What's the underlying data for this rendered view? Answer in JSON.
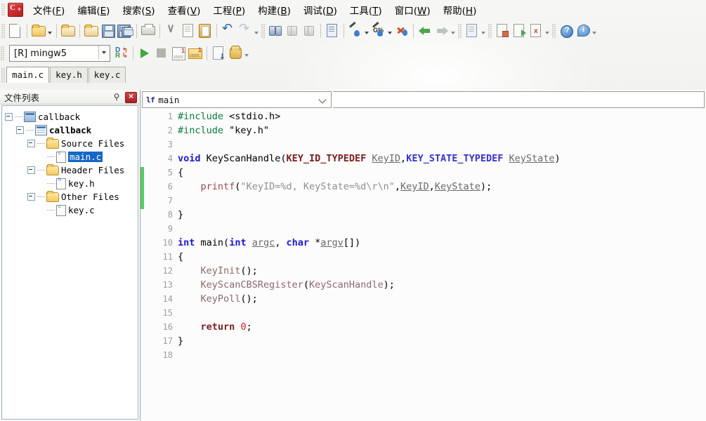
{
  "app": {
    "logo": "devcpp-logo",
    "menu": [
      {
        "label": "文件",
        "accel": "F"
      },
      {
        "label": "编辑",
        "accel": "E"
      },
      {
        "label": "搜索",
        "accel": "S"
      },
      {
        "label": "查看",
        "accel": "V"
      },
      {
        "label": "工程",
        "accel": "P"
      },
      {
        "label": "构建",
        "accel": "B"
      },
      {
        "label": "调试",
        "accel": "D"
      },
      {
        "label": "工具",
        "accel": "T"
      },
      {
        "label": "窗口",
        "accel": "W"
      },
      {
        "label": "帮助",
        "accel": "H"
      }
    ]
  },
  "toolbar": {
    "items": [
      {
        "icon": "new-file-icon"
      },
      {
        "icon": "open-folder-icon"
      },
      {
        "icon": "open-dropdown-caret"
      },
      {
        "icon": "save-project-icon"
      },
      {
        "icon": "save-as-icon"
      },
      {
        "icon": "save-icon"
      },
      {
        "icon": "save-all-icon"
      },
      {
        "icon": "print-icon"
      },
      {
        "icon": "cut-icon"
      },
      {
        "icon": "copy-icon"
      },
      {
        "icon": "paste-icon"
      },
      {
        "icon": "undo-icon"
      },
      {
        "icon": "redo-icon"
      },
      {
        "icon": "redo-dropdown-caret"
      },
      {
        "icon": "find-icon"
      },
      {
        "icon": "find-next-icon"
      },
      {
        "icon": "find-prev-icon"
      },
      {
        "icon": "goto-line-icon"
      },
      {
        "icon": "compile-icon"
      },
      {
        "icon": "compile-dropdown-caret"
      },
      {
        "icon": "compile-run-icon"
      },
      {
        "icon": "compile-run-dropdown-caret"
      },
      {
        "icon": "rebuild-icon"
      },
      {
        "icon": "back-icon"
      },
      {
        "icon": "forward-icon"
      },
      {
        "icon": "nav-dropdown-caret"
      },
      {
        "icon": "insert-snippet-icon"
      },
      {
        "icon": "toggle-bookmark-icon"
      },
      {
        "icon": "goto-bookmark-icon"
      },
      {
        "icon": "remove-bookmark-icon"
      },
      {
        "icon": "bookmark-dropdown-caret"
      },
      {
        "icon": "help-icon"
      },
      {
        "icon": "about-icon"
      },
      {
        "icon": "help-dropdown-caret"
      }
    ]
  },
  "compiler_bar": {
    "compiler_value": "[R] mingw5",
    "compiler_dropdown_icon": "chevron-down-icon",
    "items": [
      {
        "icon": "debug-run-icon"
      },
      {
        "icon": "run-icon"
      },
      {
        "icon": "stop-icon"
      },
      {
        "icon": "step-into-icon"
      },
      {
        "icon": "step-over-icon"
      },
      {
        "icon": "goto-definition-icon"
      },
      {
        "icon": "pause-icon"
      },
      {
        "icon": "debug-dropdown-caret"
      }
    ]
  },
  "file_tabs": {
    "tabs": [
      {
        "label": "main.c",
        "active": true
      },
      {
        "label": "key.h",
        "active": false
      },
      {
        "label": "key.c",
        "active": false
      }
    ]
  },
  "left_panel": {
    "title": "文件列表",
    "pin_icon": "pin-icon",
    "close_icon": "close-icon",
    "tree": [
      {
        "label": "callback",
        "indent": 0,
        "icon": "project-icon",
        "expander": true,
        "bold": false,
        "selected": false
      },
      {
        "label": "callback",
        "indent": 1,
        "icon": "subproject-icon",
        "expander": true,
        "bold": true,
        "selected": false
      },
      {
        "label": "Source Files",
        "indent": 2,
        "icon": "folder-icon",
        "expander": true,
        "bold": false,
        "selected": false
      },
      {
        "label": "main.c",
        "indent": 3,
        "icon": "c-file-icon",
        "expander": false,
        "bold": false,
        "selected": true
      },
      {
        "label": "Header Files",
        "indent": 2,
        "icon": "folder-icon",
        "expander": true,
        "bold": false,
        "selected": false
      },
      {
        "label": "key.h",
        "indent": 3,
        "icon": "h-file-icon",
        "expander": false,
        "bold": false,
        "selected": false
      },
      {
        "label": "Other Files",
        "indent": 2,
        "icon": "folder-icon",
        "expander": true,
        "bold": false,
        "selected": false
      },
      {
        "label": "key.c",
        "indent": 3,
        "icon": "c-file-icon",
        "expander": false,
        "bold": false,
        "selected": false
      }
    ]
  },
  "editor": {
    "function_selector": {
      "icon_label": "lf",
      "value": "main",
      "dropdown_icon": "chevron-down-icon"
    },
    "modified_marker_color": "#5ec85e",
    "modified_marker_lines": [
      5,
      6,
      7
    ],
    "line_numbers": [
      1,
      2,
      3,
      4,
      5,
      6,
      7,
      8,
      9,
      10,
      11,
      12,
      13,
      14,
      15,
      16,
      17,
      18
    ],
    "lines": [
      {
        "n": 1,
        "tokens": [
          {
            "t": "#include ",
            "c": "k-pp"
          },
          {
            "t": "<stdio.h>",
            "c": "k-plain"
          }
        ]
      },
      {
        "n": 2,
        "tokens": [
          {
            "t": "#include ",
            "c": "k-pp"
          },
          {
            "t": "\"key.h\"",
            "c": "k-plain"
          }
        ]
      },
      {
        "n": 3,
        "tokens": []
      },
      {
        "n": 4,
        "tokens": [
          {
            "t": "void",
            "c": "k-kw"
          },
          {
            "t": " ",
            "c": "k-plain"
          },
          {
            "t": "KeyScanHandle",
            "c": "k-plain"
          },
          {
            "t": "(",
            "c": "k-plain"
          },
          {
            "t": "KEY_ID_TYPEDEF",
            "c": "k-type"
          },
          {
            "t": " ",
            "c": "k-plain"
          },
          {
            "t": "KeyID",
            "c": "k-var"
          },
          {
            "t": ",",
            "c": "k-plain"
          },
          {
            "t": "KEY_STATE_TYPEDEF",
            "c": "k-type2"
          },
          {
            "t": " ",
            "c": "k-plain"
          },
          {
            "t": "KeyState",
            "c": "k-var"
          },
          {
            "t": ")",
            "c": "k-plain"
          }
        ]
      },
      {
        "n": 5,
        "tokens": [
          {
            "t": "{",
            "c": "k-plain"
          }
        ]
      },
      {
        "n": 6,
        "tokens": [
          {
            "t": "    ",
            "c": "k-plain"
          },
          {
            "t": "printf",
            "c": "k-fn2"
          },
          {
            "t": "(",
            "c": "k-plain"
          },
          {
            "t": "\"KeyID=%d, KeyState=%d\\r\\n\"",
            "c": "k-str"
          },
          {
            "t": ",",
            "c": "k-plain"
          },
          {
            "t": "KeyID",
            "c": "k-var"
          },
          {
            "t": ",",
            "c": "k-plain"
          },
          {
            "t": "KeyState",
            "c": "k-var"
          },
          {
            "t": ");",
            "c": "k-plain"
          }
        ]
      },
      {
        "n": 7,
        "tokens": []
      },
      {
        "n": 8,
        "tokens": [
          {
            "t": "}",
            "c": "k-plain"
          }
        ]
      },
      {
        "n": 9,
        "tokens": []
      },
      {
        "n": 10,
        "tokens": [
          {
            "t": "int",
            "c": "k-kw"
          },
          {
            "t": " ",
            "c": "k-plain"
          },
          {
            "t": "main",
            "c": "k-plain"
          },
          {
            "t": "(",
            "c": "k-plain"
          },
          {
            "t": "int",
            "c": "k-kw"
          },
          {
            "t": " ",
            "c": "k-plain"
          },
          {
            "t": "argc",
            "c": "k-var"
          },
          {
            "t": ", ",
            "c": "k-plain"
          },
          {
            "t": "char",
            "c": "k-kw"
          },
          {
            "t": " *",
            "c": "k-plain"
          },
          {
            "t": "argv",
            "c": "k-var"
          },
          {
            "t": "[])",
            "c": "k-plain"
          }
        ]
      },
      {
        "n": 11,
        "tokens": [
          {
            "t": "{",
            "c": "k-plain"
          }
        ]
      },
      {
        "n": 12,
        "tokens": [
          {
            "t": "    ",
            "c": "k-plain"
          },
          {
            "t": "KeyInit",
            "c": "k-fn"
          },
          {
            "t": "();",
            "c": "k-plain"
          }
        ]
      },
      {
        "n": 13,
        "tokens": [
          {
            "t": "    ",
            "c": "k-plain"
          },
          {
            "t": "KeyScanCBSRegister",
            "c": "k-fn"
          },
          {
            "t": "(",
            "c": "k-plain"
          },
          {
            "t": "KeyScanHandle",
            "c": "k-fn"
          },
          {
            "t": ");",
            "c": "k-plain"
          }
        ]
      },
      {
        "n": 14,
        "tokens": [
          {
            "t": "    ",
            "c": "k-plain"
          },
          {
            "t": "KeyPoll",
            "c": "k-fn"
          },
          {
            "t": "();",
            "c": "k-plain"
          }
        ]
      },
      {
        "n": 15,
        "tokens": []
      },
      {
        "n": 16,
        "tokens": [
          {
            "t": "    ",
            "c": "k-plain"
          },
          {
            "t": "return",
            "c": "k-type"
          },
          {
            "t": " ",
            "c": "k-plain"
          },
          {
            "t": "0",
            "c": "k-num"
          },
          {
            "t": ";",
            "c": "k-plain"
          }
        ]
      },
      {
        "n": 17,
        "tokens": [
          {
            "t": "}",
            "c": "k-plain"
          }
        ]
      },
      {
        "n": 18,
        "tokens": []
      }
    ]
  },
  "colors": {
    "selection_blue": "#1467c8",
    "modified_green": "#5ec85e",
    "preprocessor_green": "#0a7d3e",
    "keyword_blue": "#1a1ad6",
    "type_maroon": "#7a2020",
    "string_gray": "#8f8f8f",
    "number_red": "#d02020"
  }
}
